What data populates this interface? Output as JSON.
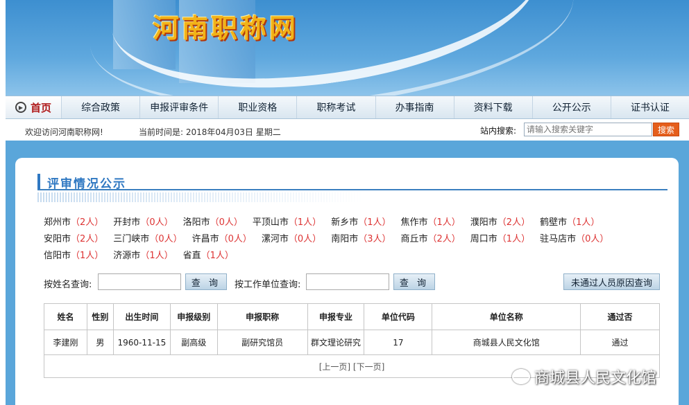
{
  "site": {
    "title": "河南职称网"
  },
  "nav": {
    "home": "首页",
    "items": [
      "综合政策",
      "申报评审条件",
      "职业资格",
      "职称考试",
      "办事指南",
      "资料下载",
      "公开公示",
      "证书认证"
    ]
  },
  "infobar": {
    "welcome": "欢迎访问河南职称网!",
    "time": "当前时间是: 2018年04月03日 星期二",
    "search_label": "站内搜索:",
    "search_placeholder": "请输入搜索关键字",
    "search_button": "搜索"
  },
  "section": {
    "title": "评审情况公示"
  },
  "cities": [
    {
      "name": "郑州市",
      "count": "（2人）"
    },
    {
      "name": "开封市",
      "count": "（0人）"
    },
    {
      "name": "洛阳市",
      "count": "（0人）"
    },
    {
      "name": "平顶山市",
      "count": "（1人）"
    },
    {
      "name": "新乡市",
      "count": "（1人）"
    },
    {
      "name": "焦作市",
      "count": "（1人）"
    },
    {
      "name": "濮阳市",
      "count": "（2人）"
    },
    {
      "name": "鹤壁市",
      "count": "（1人）"
    },
    {
      "name": "安阳市",
      "count": "（2人）"
    },
    {
      "name": "三门峡市",
      "count": "（0人）"
    },
    {
      "name": "许昌市",
      "count": "（0人）"
    },
    {
      "name": "漯河市",
      "count": "（0人）"
    },
    {
      "name": "南阳市",
      "count": "（3人）"
    },
    {
      "name": "商丘市",
      "count": "（2人）"
    },
    {
      "name": "周口市",
      "count": "（1人）"
    },
    {
      "name": "驻马店市",
      "count": "（0人）"
    },
    {
      "name": "信阳市",
      "count": "（1人）"
    },
    {
      "name": "济源市",
      "count": "（1人）"
    },
    {
      "name": "省直",
      "count": "（1人）"
    }
  ],
  "query": {
    "name_label": "按姓名查询:",
    "unit_label": "按工作单位查询:",
    "button": "查 询",
    "fail_button": "未通过人员原因查询"
  },
  "table": {
    "headers": [
      "姓名",
      "性别",
      "出生时间",
      "申报级别",
      "申报职称",
      "申报专业",
      "单位代码",
      "单位名称",
      "通过否"
    ],
    "rows": [
      [
        "李建刚",
        "男",
        "1960-11-15",
        "副高级",
        "副研究馆员",
        "群文理论研究",
        "17",
        "商城县人民文化馆",
        "通过"
      ]
    ],
    "pager": "[上一页] [下一页]"
  },
  "watermark": "商城县人民文化馆"
}
